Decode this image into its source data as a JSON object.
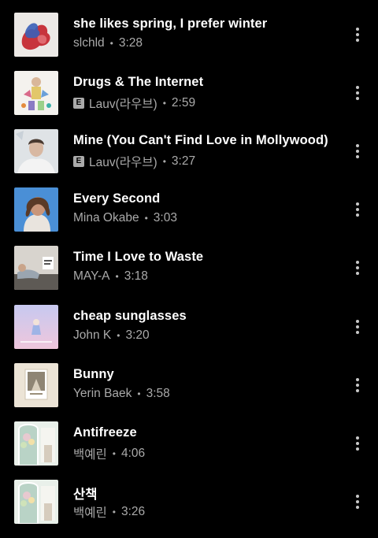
{
  "songs": [
    {
      "title": "she likes spring, I prefer winter",
      "artist": "slchld",
      "duration": "3:28",
      "explicit": false,
      "art_icon": "abstract-art-red-blue",
      "explicit_label": ""
    },
    {
      "title": "Drugs & The Internet",
      "artist": "Lauv(라우브)",
      "duration": "2:59",
      "explicit": true,
      "art_icon": "figure-collage-art",
      "explicit_label": "E"
    },
    {
      "title": "Mine (You Can't Find Love in Mollywood)",
      "artist": "Lauv(라우브)",
      "duration": "3:27",
      "explicit": true,
      "art_icon": "portrait-art",
      "explicit_label": "E"
    },
    {
      "title": "Every Second",
      "artist": "Mina Okabe",
      "duration": "3:03",
      "explicit": false,
      "art_icon": "portrait-blue-sky-art",
      "explicit_label": ""
    },
    {
      "title": "Time I Love to Waste",
      "artist": "MAY-A",
      "duration": "3:18",
      "explicit": false,
      "art_icon": "reclining-figure-art",
      "explicit_label": ""
    },
    {
      "title": "cheap sunglasses",
      "artist": "John K",
      "duration": "3:20",
      "explicit": false,
      "art_icon": "pastel-figure-art",
      "explicit_label": ""
    },
    {
      "title": "Bunny",
      "artist": "Yerin Baek",
      "duration": "3:58",
      "explicit": false,
      "art_icon": "framed-photo-art",
      "explicit_label": ""
    },
    {
      "title": "Antifreeze",
      "artist": "백예린",
      "duration": "4:06",
      "explicit": false,
      "art_icon": "window-bouquet-art",
      "explicit_label": ""
    },
    {
      "title": "산책",
      "artist": "백예린",
      "duration": "3:26",
      "explicit": false,
      "art_icon": "window-bouquet-art",
      "explicit_label": ""
    }
  ],
  "colors": {
    "background": "#000000",
    "title": "#ffffff",
    "secondary": "#aaaaaa"
  },
  "separator": "•",
  "more_icon": "more-vertical-icon"
}
